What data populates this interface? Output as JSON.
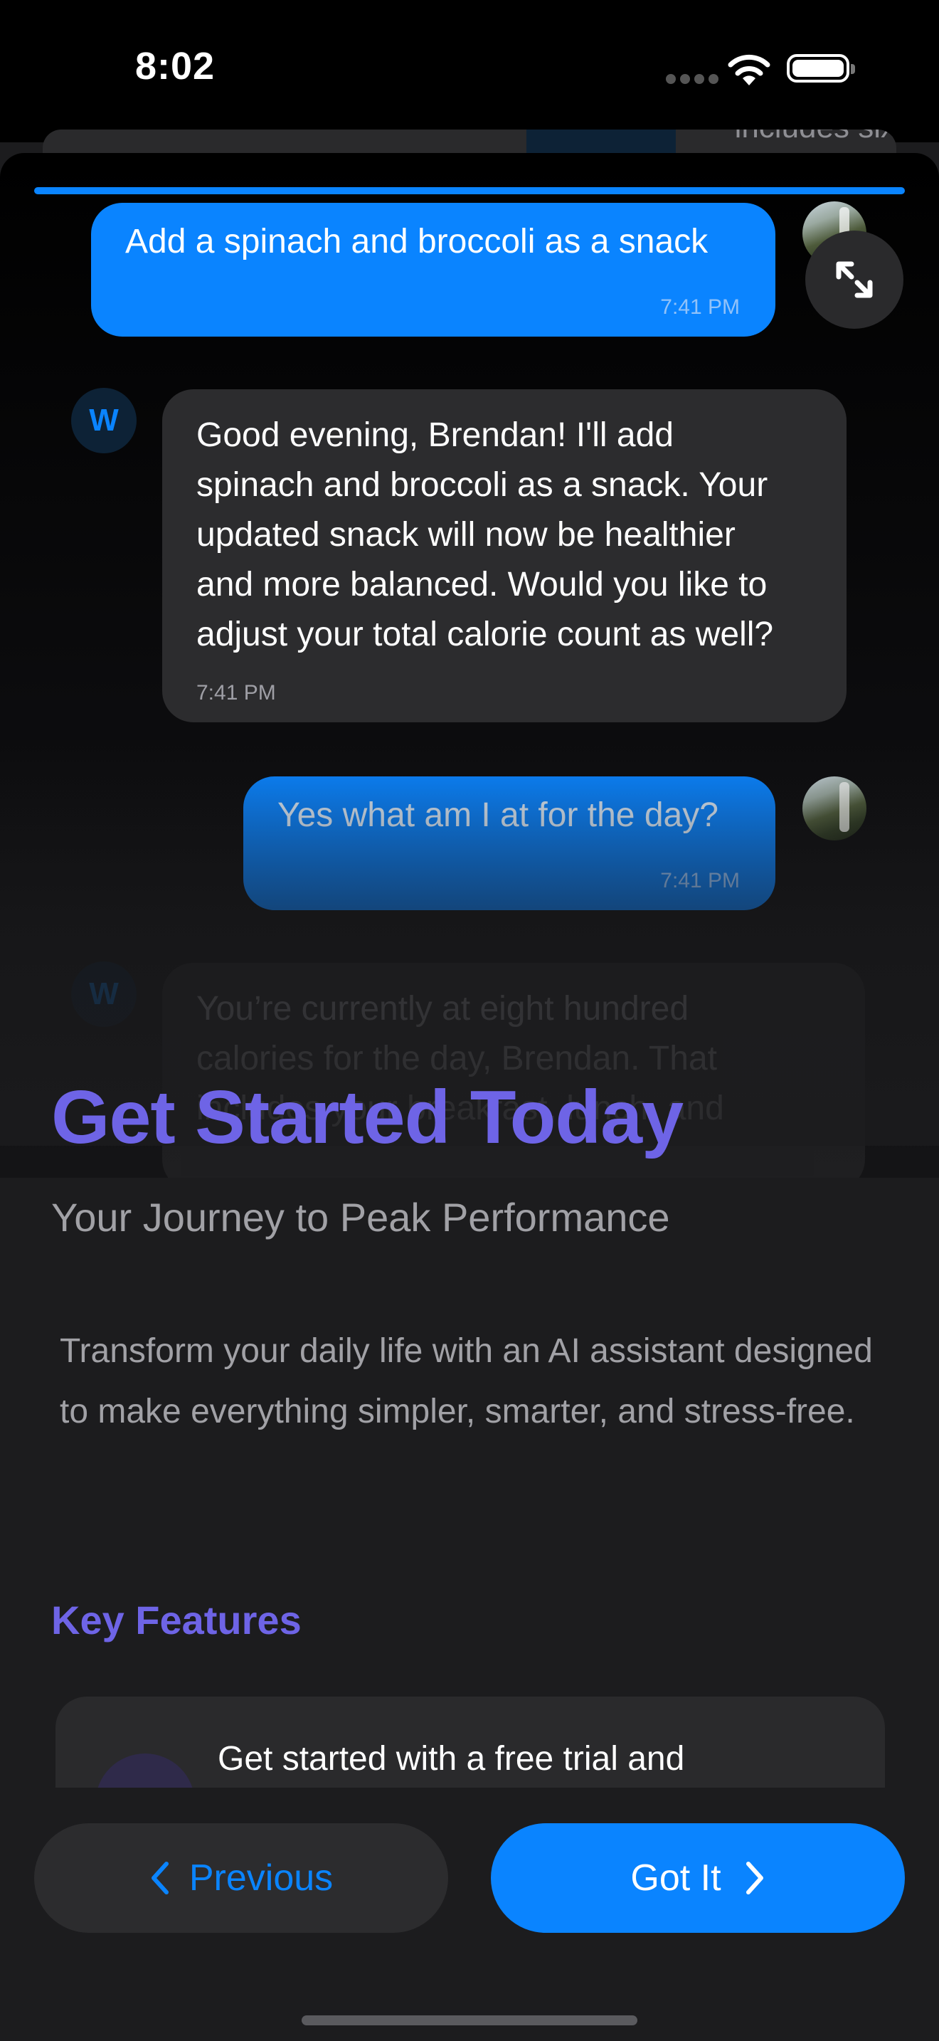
{
  "status_bar": {
    "time": "8:02"
  },
  "background_peek": {
    "text": "includes six"
  },
  "chat": {
    "messages": [
      {
        "role": "user",
        "text": "Add a spinach and broccoli as a snack",
        "time": "7:41 PM"
      },
      {
        "role": "assistant",
        "avatar_letter": "W",
        "lines": [
          "Good evening, Brendan! I'll add",
          "spinach and broccoli as a snack. Your",
          "updated snack will now be healthier",
          "and more balanced. Would you like to",
          "adjust your total calorie count as well?"
        ],
        "time": "7:41 PM"
      },
      {
        "role": "user",
        "text": "Yes what am I at for the day?",
        "time": "7:41 PM"
      },
      {
        "role": "assistant",
        "avatar_letter": "W",
        "lines": [
          "You’re currently at eight hundred",
          "calories for the day, Brendan. That",
          "includes your breakfast, lunch, and"
        ]
      }
    ]
  },
  "onboarding": {
    "title": "Get Started Today",
    "subtitle": "Your Journey to Peak Performance",
    "intro": "Transform your daily life with an AI assistant designed to make everything simpler, smarter, and stress-free.",
    "features_heading": "Key Features",
    "feature_1": "Get started with a free trial and"
  },
  "nav": {
    "previous_label": "Previous",
    "next_label": "Got It"
  },
  "colors": {
    "accent_blue": "#0a84ff",
    "title_purple": "#6e64e6",
    "background": "#1c1c1e"
  },
  "icons": [
    "wifi-icon",
    "battery-icon",
    "expand-icon",
    "chevron-left-icon",
    "chevron-right-icon"
  ]
}
